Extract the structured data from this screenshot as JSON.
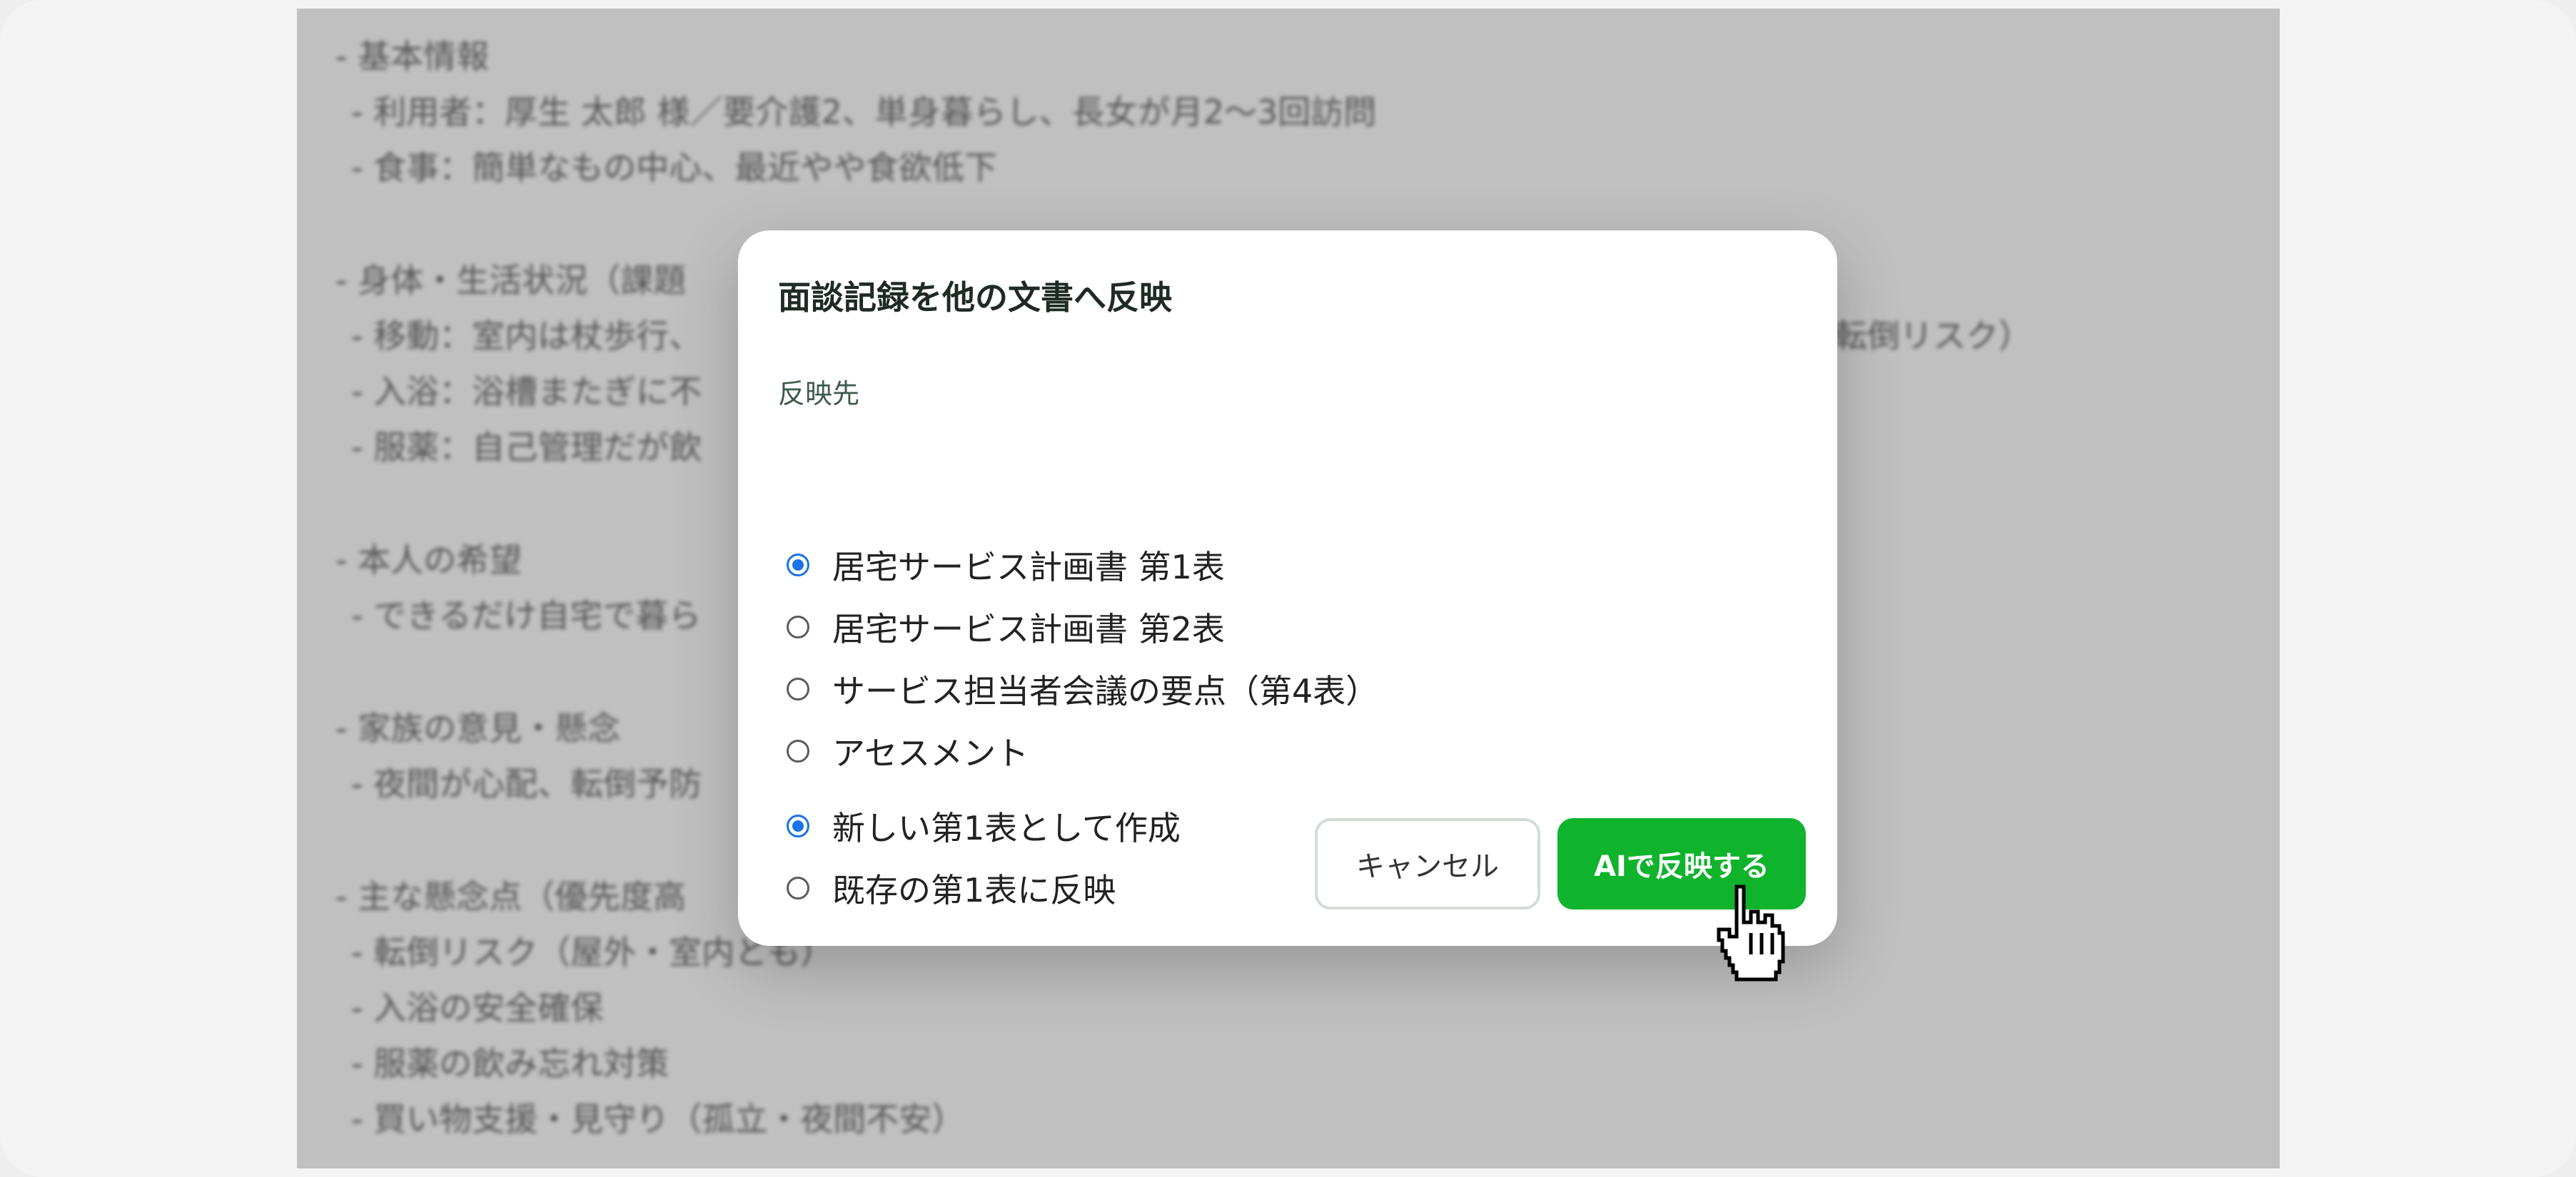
{
  "background_document": {
    "lines": [
      {
        "text": "- 基本情報",
        "sub": false
      },
      {
        "text": "- 利用者：厚生 太郎 様／要介護2、単身暮らし、長女が月2〜3回訪問",
        "sub": true
      },
      {
        "text": "- 食事：簡単なもの中心、最近やや食欲低下",
        "sub": true
      },
      {
        "text": "",
        "gap": true
      },
      {
        "text": "- 身体・生活状況（課題",
        "sub": false
      },
      {
        "text": "- 移動：室内は杖歩行、",
        "sub": true,
        "tail": "転倒リスク）"
      },
      {
        "text": "- 入浴：浴槽またぎに不",
        "sub": true
      },
      {
        "text": "- 服薬：自己管理だが飲",
        "sub": true
      },
      {
        "text": "",
        "gap": true
      },
      {
        "text": "- 本人の希望",
        "sub": false
      },
      {
        "text": "- できるだけ自宅で暮ら",
        "sub": true
      },
      {
        "text": "",
        "gap": true
      },
      {
        "text": "- 家族の意見・懸念",
        "sub": false
      },
      {
        "text": "- 夜間が心配、転倒予防",
        "sub": true
      },
      {
        "text": "",
        "gap": true
      },
      {
        "text": "- 主な懸念点（優先度高",
        "sub": false
      },
      {
        "text": "- 転倒リスク（屋外・室内とも）",
        "sub": true
      },
      {
        "text": "- 入浴の安全確保",
        "sub": true
      },
      {
        "text": "- 服薬の飲み忘れ対策",
        "sub": true
      },
      {
        "text": "- 買い物支援・見守り（孤立・夜間不安）",
        "sub": true
      }
    ]
  },
  "modal": {
    "title": "面談記録を他の文書へ反映",
    "section_label": "反映先",
    "targets": [
      {
        "label": "居宅サービス計画書 第1表",
        "selected": true
      },
      {
        "label": "居宅サービス計画書 第2表",
        "selected": false
      },
      {
        "label": "サービス担当者会議の要点（第4表）",
        "selected": false
      },
      {
        "label": "アセスメント",
        "selected": false
      }
    ],
    "modes": [
      {
        "label": "新しい第1表として作成",
        "selected": true
      },
      {
        "label": "既存の第1表に反映",
        "selected": false
      }
    ],
    "cancel_label": "キャンセル",
    "submit_label": "AIで反映する"
  },
  "colors": {
    "primary": "#0fb32c",
    "radio_selected": "#1a73e8",
    "overlay_doc": "#c0c0c0"
  },
  "cursor": "hand-pointer-icon"
}
